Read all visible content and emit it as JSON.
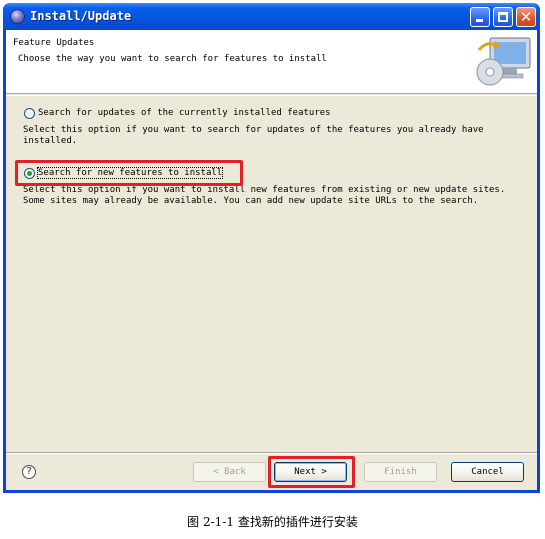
{
  "window": {
    "title": "Install/Update"
  },
  "header": {
    "title": "Feature Updates",
    "description": "Choose the way you want to search for features to install"
  },
  "options": [
    {
      "label": "Search for updates of the currently installed features",
      "description": "Select this option if you want to search for updates of the features you already have\ninstalled.",
      "checked": false
    },
    {
      "label": "Search for new features to install",
      "description": "Select this option if you want to install new features from existing or new update sites.\nSome sites may already be available. You can add new update site URLs to the search.",
      "checked": true
    }
  ],
  "buttons": {
    "back": "< Back",
    "next": "Next >",
    "finish": "Finish",
    "cancel": "Cancel"
  },
  "help_icon": "?",
  "caption": "图 2-1-1  查找新的插件进行安装",
  "colors": {
    "highlight": "#e0202a",
    "titlebar": "#0553dd",
    "dialog_bg": "#ece9d8"
  }
}
